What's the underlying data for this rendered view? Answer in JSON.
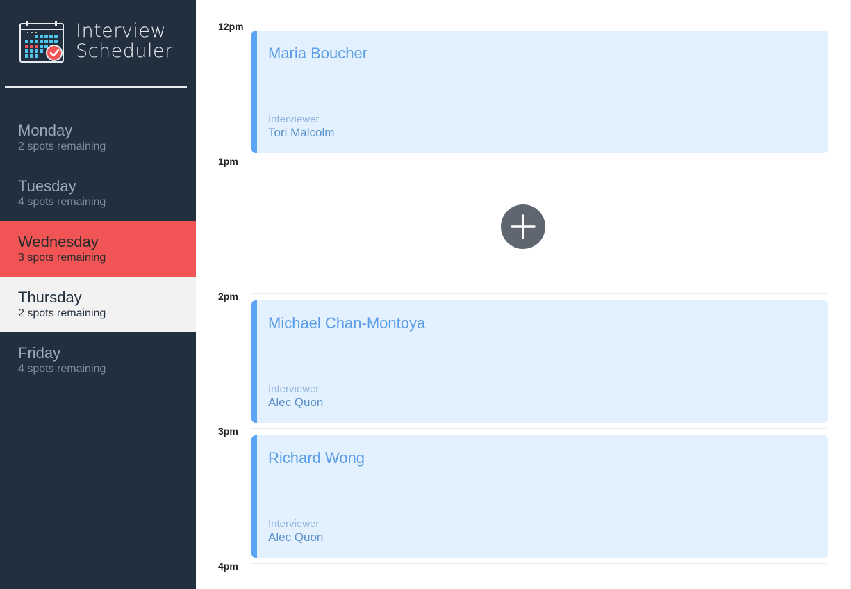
{
  "app": {
    "title_line1": "Interview",
    "title_line2": "Scheduler"
  },
  "sidebar": {
    "days": [
      {
        "name": "Monday",
        "spots": "2 spots remaining",
        "state": "normal"
      },
      {
        "name": "Tuesday",
        "spots": "4 spots remaining",
        "state": "normal"
      },
      {
        "name": "Wednesday",
        "spots": "3 spots remaining",
        "state": "selected"
      },
      {
        "name": "Thursday",
        "spots": "2 spots remaining",
        "state": "hover"
      },
      {
        "name": "Friday",
        "spots": "4 spots remaining",
        "state": "normal"
      }
    ]
  },
  "schedule": {
    "times": [
      "12pm",
      "1pm",
      "2pm",
      "3pm",
      "4pm"
    ],
    "interviewer_label": "Interviewer",
    "appointments": [
      {
        "time": "12pm",
        "student": "Maria Boucher",
        "interviewer": "Tori Malcolm"
      },
      {
        "time": "1pm",
        "empty": true
      },
      {
        "time": "2pm",
        "student": "Michael Chan-Montoya",
        "interviewer": "Alec Quon"
      },
      {
        "time": "3pm",
        "student": "Richard Wong",
        "interviewer": "Alec Quon"
      }
    ]
  },
  "colors": {
    "sidebar_bg": "#222f3e",
    "selected_bg": "#f05454",
    "hover_bg": "#f2f2f2",
    "appointment_bg": "#e3f0fd",
    "appointment_accent": "#5ba4f6",
    "add_button_bg": "#5f6670"
  },
  "icons": {
    "logo": "calendar-check-icon",
    "add": "plus-icon"
  }
}
